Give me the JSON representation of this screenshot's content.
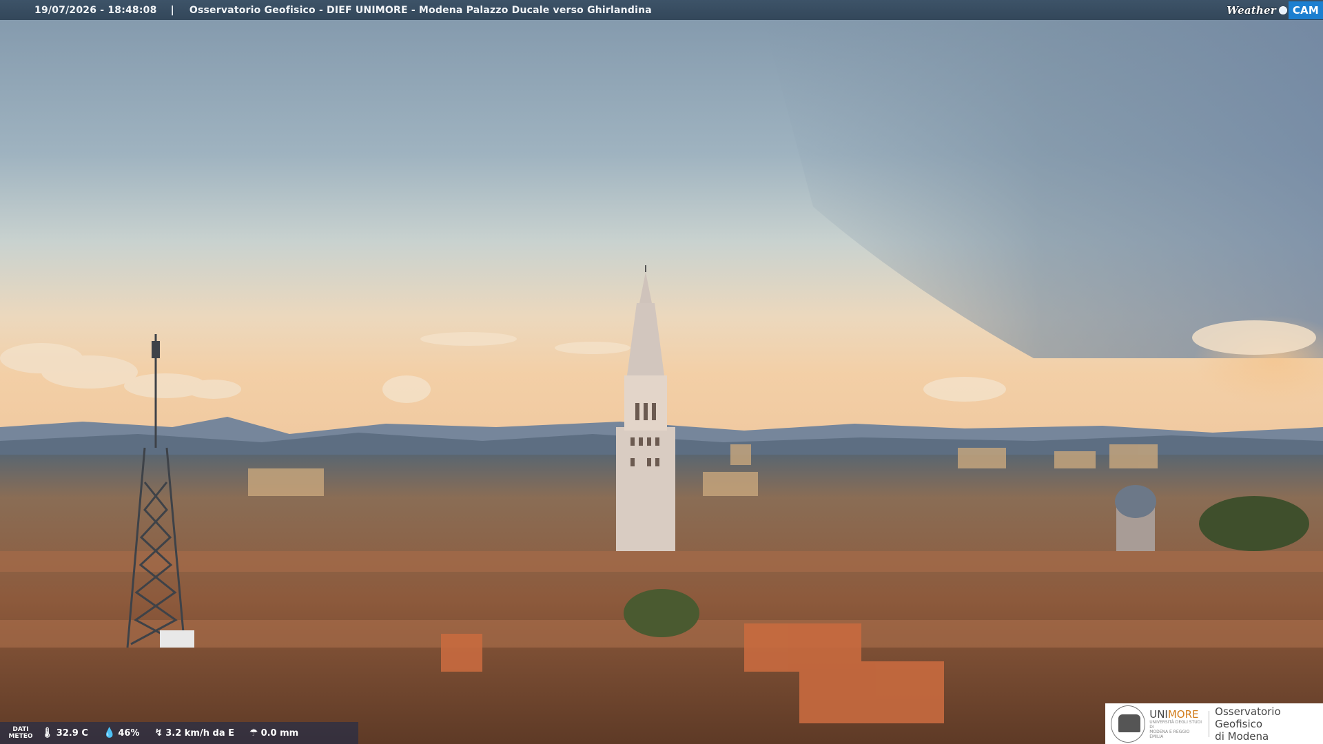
{
  "header": {
    "timestamp": "19/07/2026 - 18:48:08",
    "separator": "|",
    "title": "Osservatorio Geofisico - DIEF UNIMORE - Modena Palazzo Ducale verso Ghirlandina",
    "brand_weather": "Weather",
    "brand_cam": "CAM"
  },
  "meteo": {
    "label_line1": "DATI",
    "label_line2": "METEO",
    "temperature": "32.9 C",
    "humidity": "46%",
    "wind": "3.2 km/h da E",
    "rain": "0.0 mm",
    "icons": [
      "thermometer-icon",
      "humidity-drop-icon",
      "wind-icon",
      "rain-gauge-icon"
    ]
  },
  "logo": {
    "unimore_uni": "UNI",
    "unimore_more": "MORE",
    "unimore_sub1": "UNIVERSITÀ DEGLI STUDI DI",
    "unimore_sub2": "MODENA E REGGIO EMILIA",
    "observatory_line1": "Osservatorio Geofisico",
    "observatory_line2": "di Modena"
  },
  "colors": {
    "bar": "#33475a",
    "cam_blue": "#1c7fd0",
    "unimore_orange": "#d27d1c"
  }
}
